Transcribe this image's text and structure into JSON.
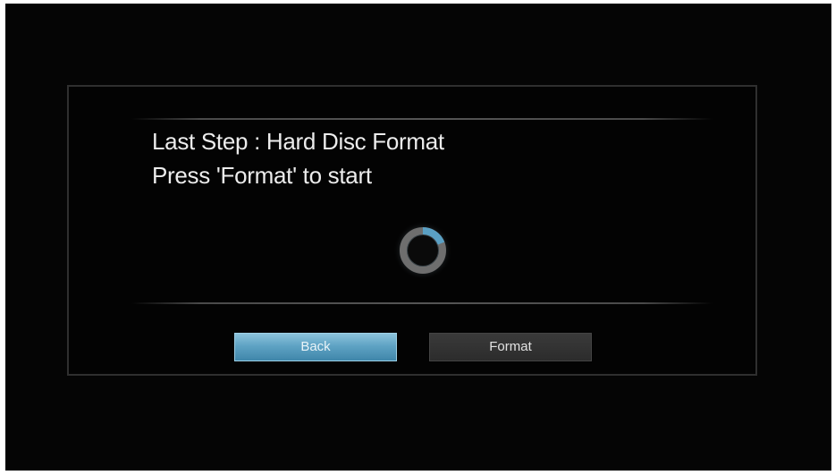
{
  "dialog": {
    "heading": "Last Step : Hard Disc Format",
    "instruction": "Press 'Format' to start",
    "spinner_icon": "loading-spinner-icon"
  },
  "buttons": {
    "back_label": "Back",
    "format_label": "Format"
  },
  "colors": {
    "background": "#050505",
    "accent": "#5fa3c4",
    "text": "#ececec"
  }
}
